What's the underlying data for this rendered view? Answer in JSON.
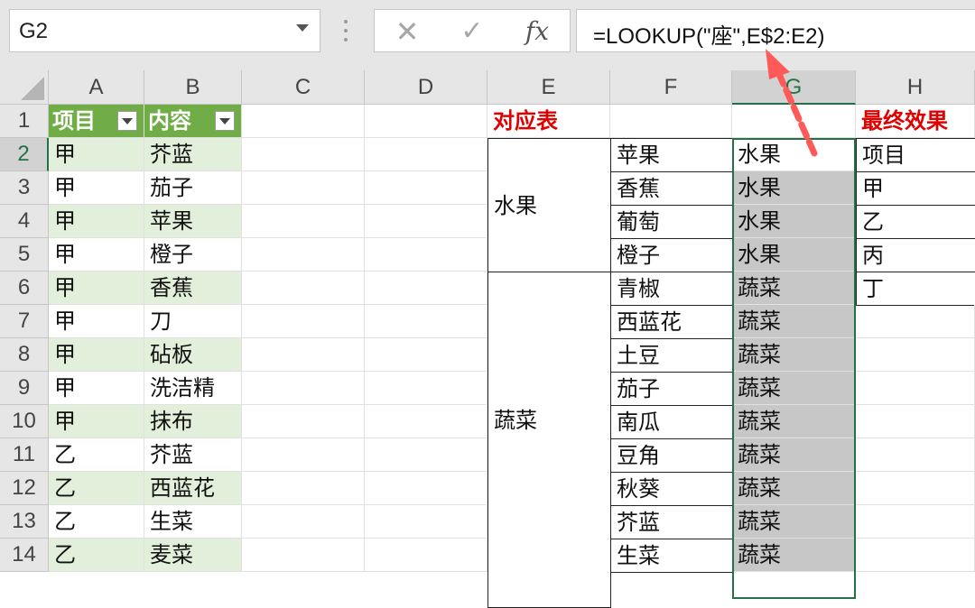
{
  "namebox": {
    "value": "G2"
  },
  "formula_bar": {
    "cancel_icon": "✕",
    "enter_icon": "✓",
    "fx_label": "fx",
    "formula": "=LOOKUP(\"座\",E$2:E2)"
  },
  "columns": [
    "A",
    "B",
    "C",
    "D",
    "E",
    "F",
    "G",
    "H"
  ],
  "rows": [
    "1",
    "2",
    "3",
    "4",
    "5",
    "6",
    "7",
    "8",
    "9",
    "10",
    "11",
    "12",
    "13",
    "14"
  ],
  "table": {
    "headers": [
      "项目",
      "内容"
    ],
    "col_a": [
      "甲",
      "甲",
      "甲",
      "甲",
      "甲",
      "甲",
      "甲",
      "甲",
      "甲",
      "乙",
      "乙",
      "乙",
      "乙"
    ],
    "col_b": [
      "芥蓝",
      "茄子",
      "苹果",
      "橙子",
      "香蕉",
      "刀",
      "砧板",
      "洗洁精",
      "抹布",
      "芥蓝",
      "西蓝花",
      "生菜",
      "麦菜"
    ]
  },
  "mapping": {
    "title": "对应表",
    "group_fruit": "水果",
    "group_veg": "蔬菜",
    "col_f": [
      "苹果",
      "香蕉",
      "葡萄",
      "橙子",
      "青椒",
      "西蓝花",
      "土豆",
      "茄子",
      "南瓜",
      "豆角",
      "秋葵",
      "芥蓝",
      "生菜"
    ],
    "col_g": [
      "水果",
      "水果",
      "水果",
      "水果",
      "蔬菜",
      "蔬菜",
      "蔬菜",
      "蔬菜",
      "蔬菜",
      "蔬菜",
      "蔬菜",
      "蔬菜",
      "蔬菜"
    ]
  },
  "result": {
    "title": "最终效果",
    "col_h": [
      "项目",
      "甲",
      "乙",
      "丙",
      "丁"
    ]
  },
  "colors": {
    "accent": "#217346",
    "table_header": "#70ad47",
    "band": "#e2efda",
    "red": "#e00000",
    "arrow": "#ff5a5a"
  }
}
